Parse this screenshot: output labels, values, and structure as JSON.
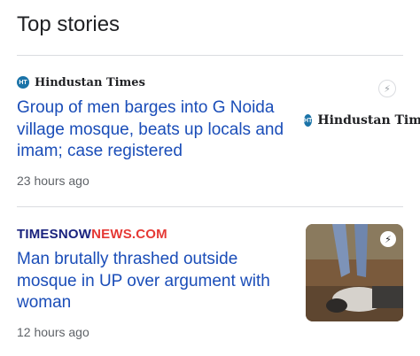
{
  "section": {
    "title": "Top stories"
  },
  "stories": [
    {
      "source": "Hindustan Times",
      "source_badge": "HT",
      "headline": "Group of men barges into G Noida village mosque, beats up locals and imam; case registered",
      "time": "23 hours ago",
      "thumbnail_text": "Hindustan Tim",
      "icon": "amp-bolt-icon"
    },
    {
      "source_part1": "TIMESNOW",
      "source_part2": "NEWS.COM",
      "headline": "Man brutally thrashed outside mosque in UP over argument with woman",
      "time": "12 hours ago",
      "icon": "amp-bolt-icon"
    }
  ],
  "colors": {
    "headline": "#1a4db8",
    "meta": "#5f6368",
    "divider": "#dadce0"
  }
}
